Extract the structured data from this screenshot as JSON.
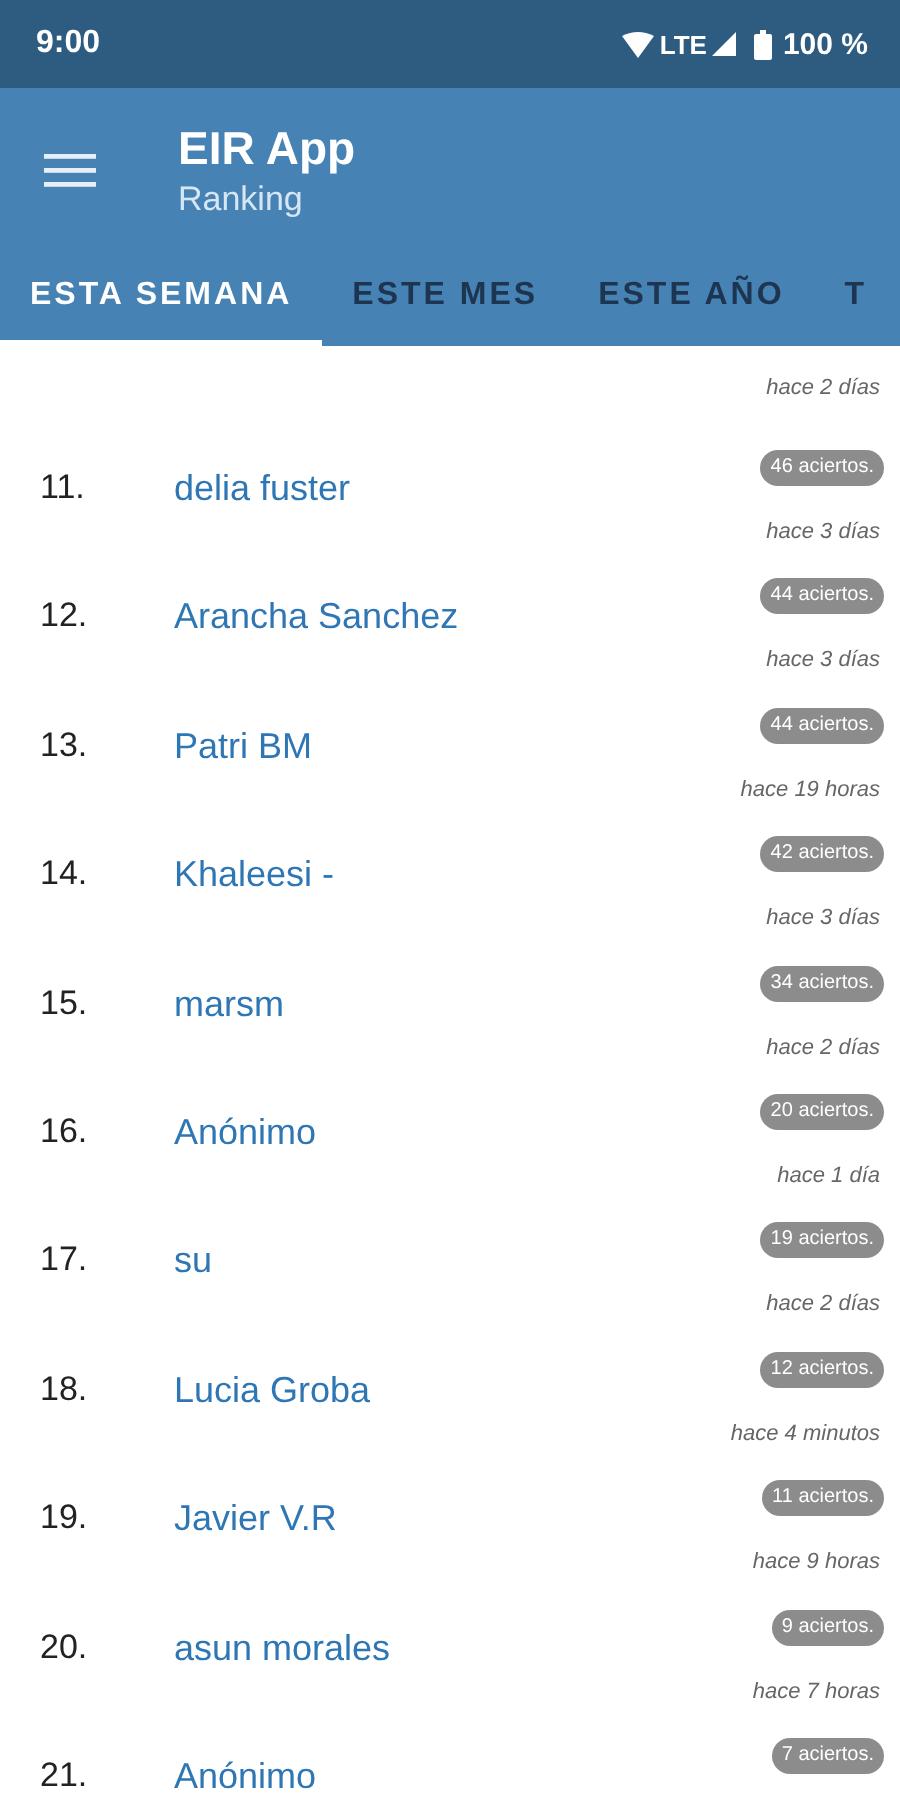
{
  "status_bar": {
    "time": "9:00",
    "network": "LTE",
    "battery": "100 %"
  },
  "app_bar": {
    "title": "EIR App",
    "subtitle": "Ranking"
  },
  "tabs": [
    {
      "label": "ESTA SEMANA",
      "selected": true
    },
    {
      "label": "ESTE MES",
      "selected": false
    },
    {
      "label": "ESTE AÑO",
      "selected": false
    },
    {
      "label": "T",
      "selected": false
    }
  ],
  "previous_time": "hace 2 días",
  "ranking": [
    {
      "rank": "11.",
      "name": "delia fuster",
      "score": "46 aciertos.",
      "time": "hace 3 días"
    },
    {
      "rank": "12.",
      "name": "Arancha Sanchez",
      "score": "44 aciertos.",
      "time": "hace 3 días"
    },
    {
      "rank": "13.",
      "name": "Patri BM",
      "score": "44 aciertos.",
      "time": "hace 19 horas"
    },
    {
      "rank": "14.",
      "name": "Khaleesi -",
      "score": "42 aciertos.",
      "time": "hace 3 días"
    },
    {
      "rank": "15.",
      "name": "marsm",
      "score": "34 aciertos.",
      "time": "hace 2 días"
    },
    {
      "rank": "16.",
      "name": "Anónimo",
      "score": "20 aciertos.",
      "time": "hace 1 día"
    },
    {
      "rank": "17.",
      "name": "su",
      "score": "19 aciertos.",
      "time": "hace 2 días"
    },
    {
      "rank": "18.",
      "name": "Lucia Groba",
      "score": "12 aciertos.",
      "time": "hace 4 minutos"
    },
    {
      "rank": "19.",
      "name": "Javier V.R",
      "score": "11 aciertos.",
      "time": "hace 9 horas"
    },
    {
      "rank": "20.",
      "name": "asun morales",
      "score": "9 aciertos.",
      "time": "hace 7 horas"
    },
    {
      "rank": "21.",
      "name": "Anónimo",
      "score": "7 aciertos."
    }
  ]
}
